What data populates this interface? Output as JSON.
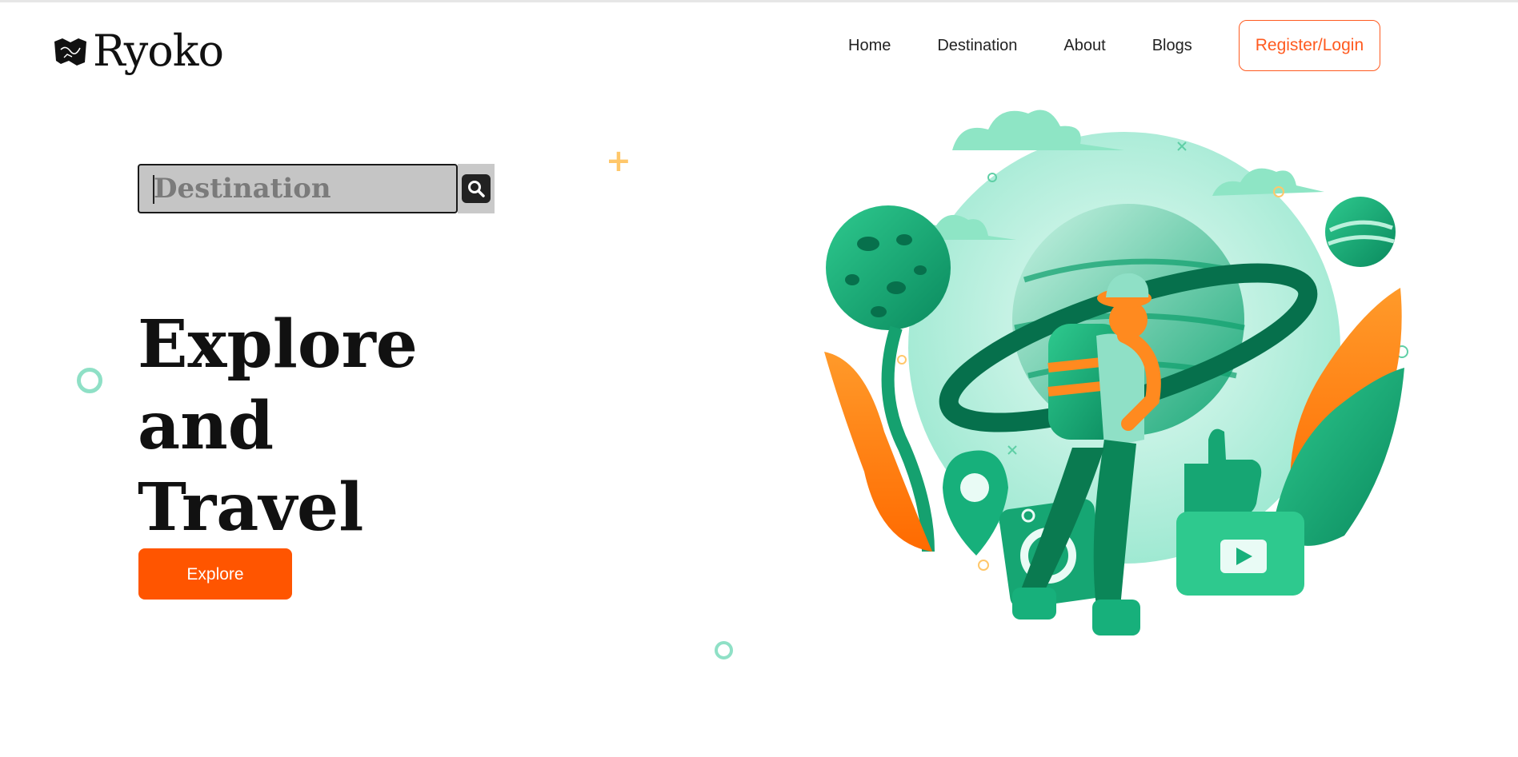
{
  "header": {
    "logo_text": "Ryoko",
    "nav": [
      {
        "label": "Home"
      },
      {
        "label": "Destination"
      },
      {
        "label": "About"
      },
      {
        "label": "Blogs"
      }
    ],
    "register_label": "Register/Login"
  },
  "search": {
    "placeholder": "Destination",
    "value": "",
    "icon": "search-icon"
  },
  "hero": {
    "title_line1": "Explore and",
    "title_line2": "Travel",
    "cta_label": "Explore"
  },
  "colors": {
    "accent": "#ff5500",
    "nav_button_border": "#ff5a1f",
    "green": "#1fb57e",
    "mint": "#c8f5e8",
    "orange": "#ff8a1f"
  }
}
